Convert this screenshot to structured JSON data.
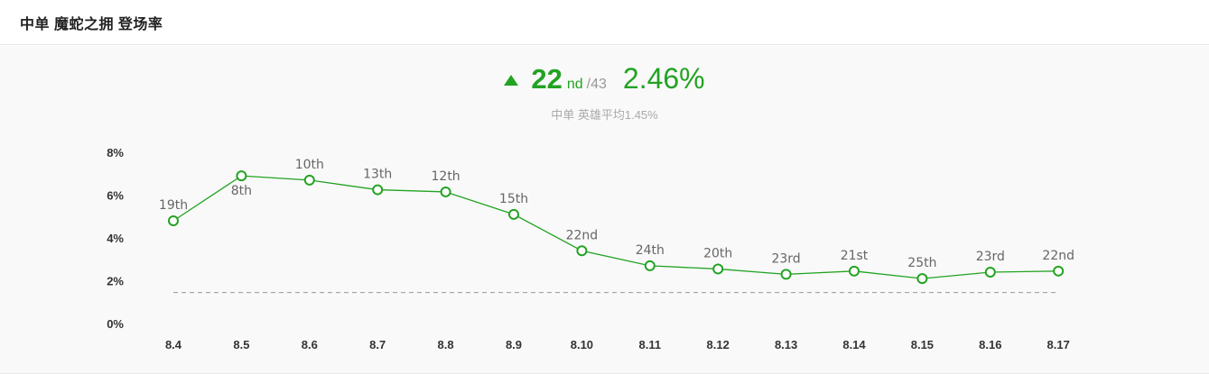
{
  "header": {
    "title": "中单 魔蛇之拥 登场率"
  },
  "summary": {
    "rank": "22",
    "rank_suffix": "nd",
    "rank_total": "/43",
    "rate": "2.46%",
    "subline": "中单 英雄平均1.45%",
    "trend_icon": "up-triangle-icon",
    "accent_color": "#22a322"
  },
  "chart_data": {
    "type": "line",
    "categories": [
      "8.4",
      "8.5",
      "8.6",
      "8.7",
      "8.8",
      "8.9",
      "8.10",
      "8.11",
      "8.12",
      "8.13",
      "8.14",
      "8.15",
      "8.16",
      "8.17"
    ],
    "values": [
      4.8,
      6.9,
      6.7,
      6.25,
      6.15,
      5.1,
      3.4,
      2.7,
      2.55,
      2.3,
      2.45,
      2.1,
      2.4,
      2.45
    ],
    "point_labels": [
      "19th",
      "8th",
      "10th",
      "13th",
      "12th",
      "15th",
      "22nd",
      "24th",
      "20th",
      "23rd",
      "21st",
      "25th",
      "23rd",
      "22nd"
    ],
    "yticks": [
      "0%",
      "2%",
      "4%",
      "6%",
      "8%"
    ],
    "ylim": [
      0,
      8
    ],
    "average": 1.45,
    "line_color": "#22a322",
    "average_line_color": "#999999"
  }
}
